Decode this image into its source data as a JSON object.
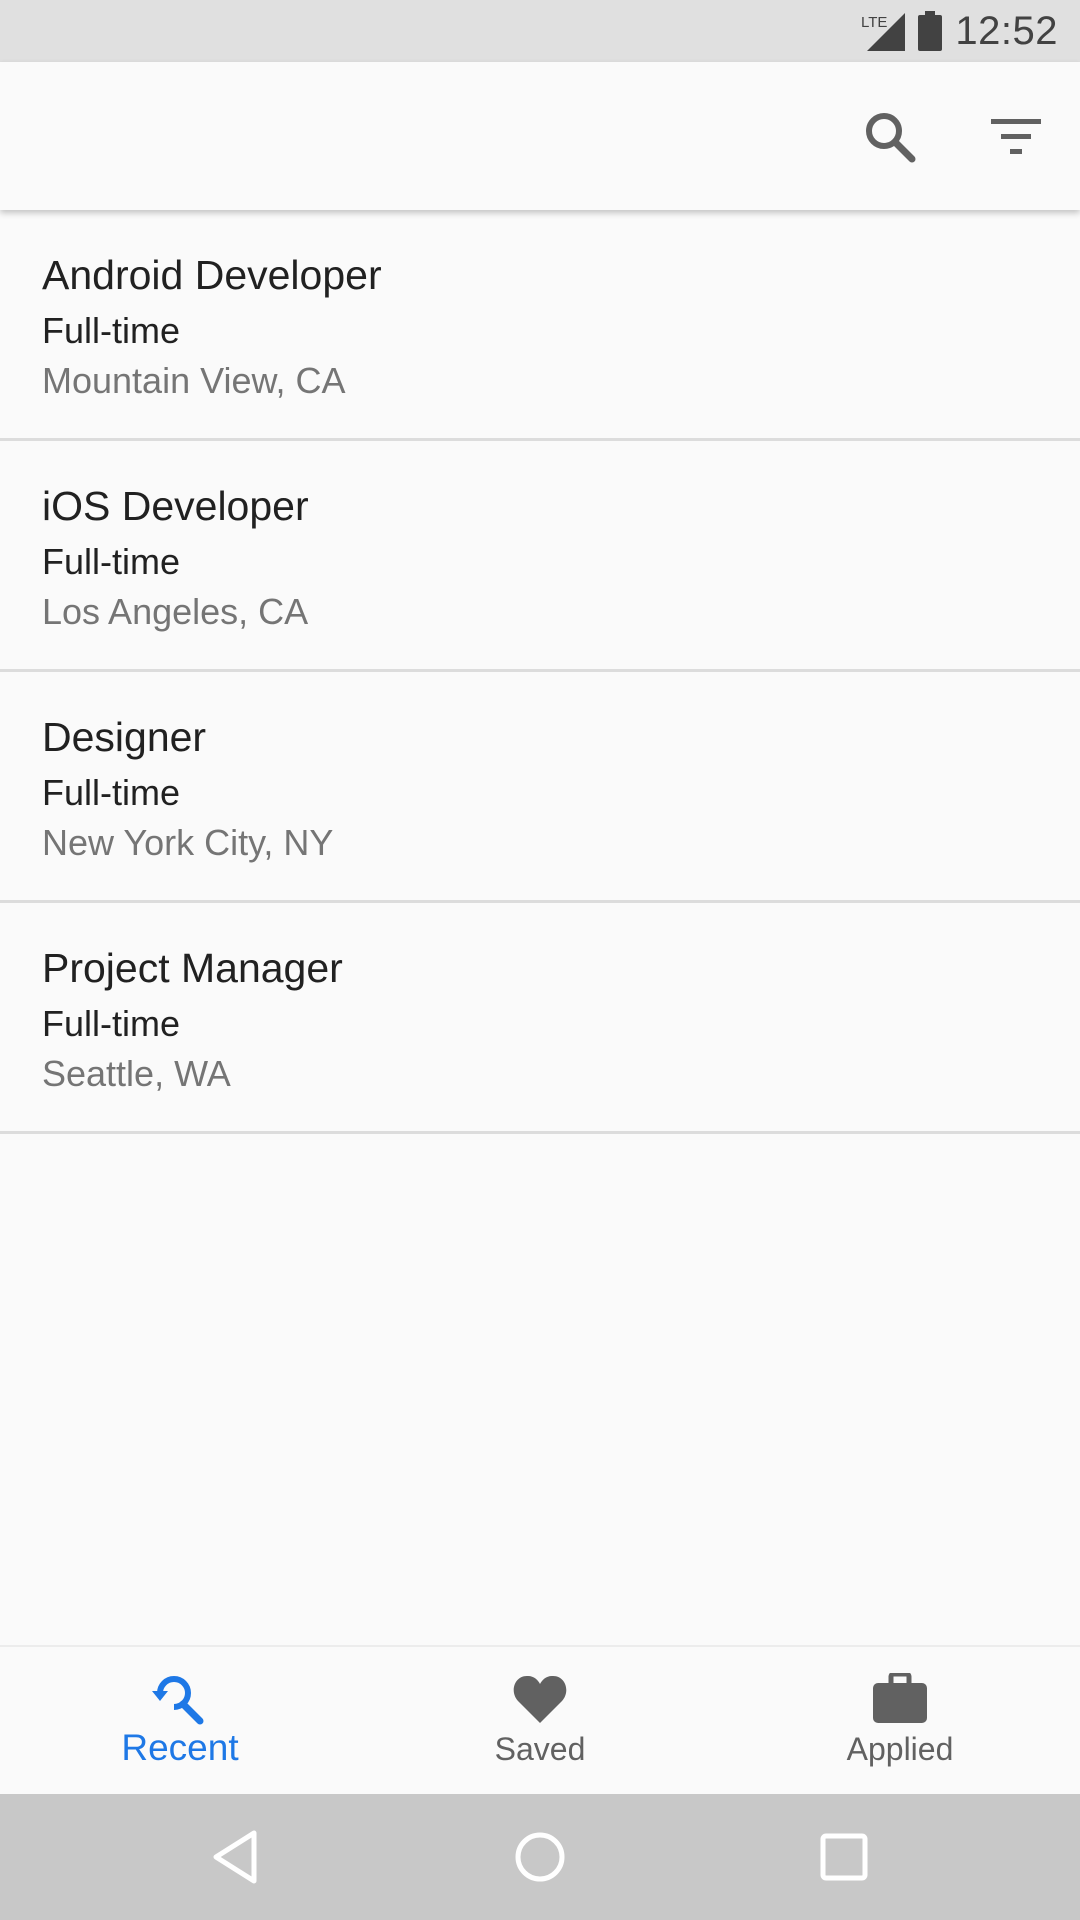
{
  "status_bar": {
    "network_label": "LTE",
    "time": "12:52"
  },
  "toolbar": {
    "icons": [
      "search-icon",
      "filter-icon"
    ]
  },
  "jobs": [
    {
      "title": "Android Developer",
      "type": "Full-time",
      "location": "Mountain View, CA"
    },
    {
      "title": "iOS Developer",
      "type": "Full-time",
      "location": "Los Angeles, CA"
    },
    {
      "title": "Designer",
      "type": "Full-time",
      "location": "New York City, NY"
    },
    {
      "title": "Project Manager",
      "type": "Full-time",
      "location": "Seattle, WA"
    }
  ],
  "bottom_nav": {
    "items": [
      {
        "label": "Recent",
        "icon": "search-refresh-icon",
        "active": true
      },
      {
        "label": "Saved",
        "icon": "heart-icon",
        "active": false
      },
      {
        "label": "Applied",
        "icon": "briefcase-icon",
        "active": false
      }
    ]
  },
  "colors": {
    "accent": "#1e78e6",
    "icon": "#616161",
    "status_bar_bg": "#e0e0e0",
    "system_nav_bg": "#c8c8c8"
  }
}
